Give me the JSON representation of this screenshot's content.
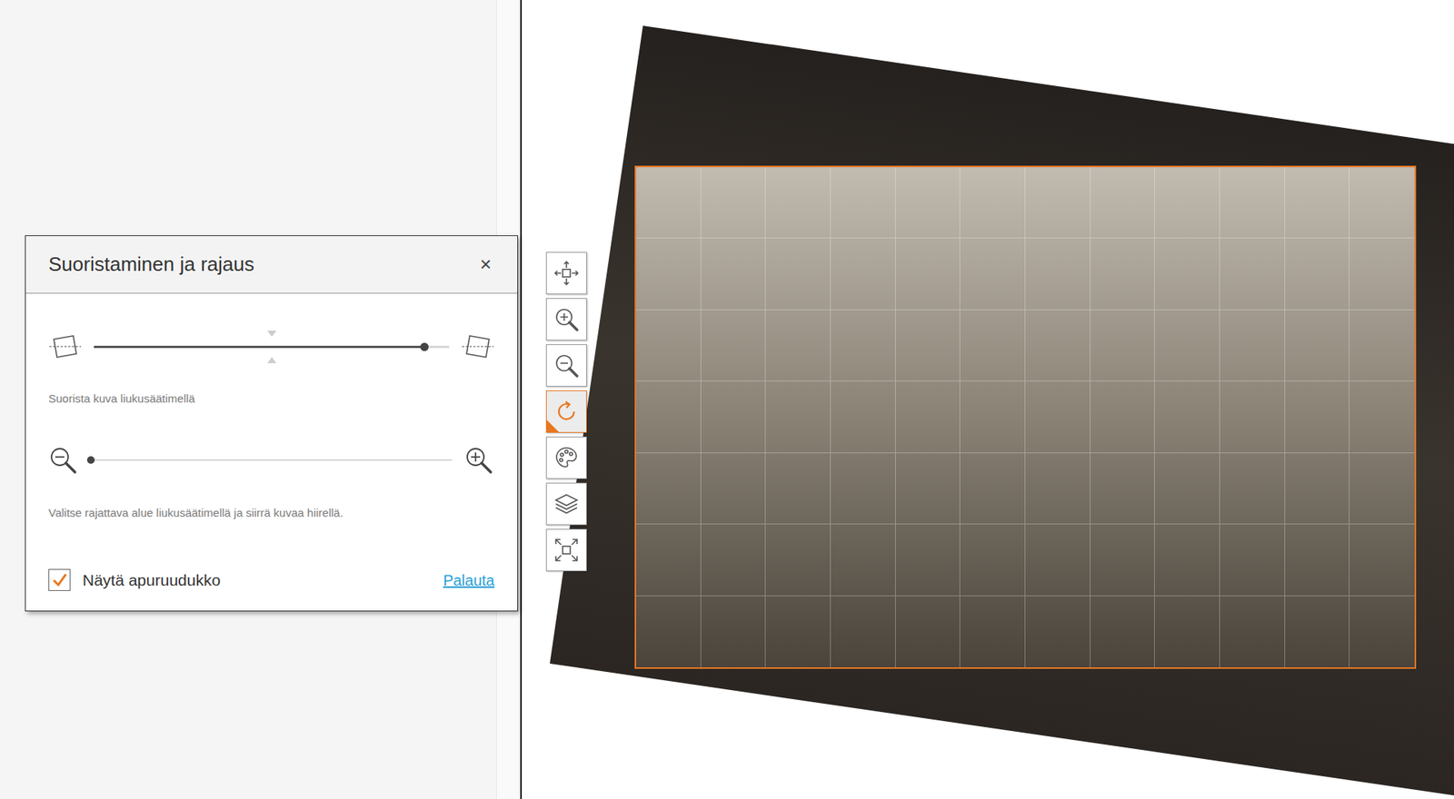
{
  "dialog": {
    "title": "Suoristaminen ja rajaus",
    "close": "×",
    "straighten": {
      "level": 0.93,
      "hint": "Suorista kuva liukusäätimellä"
    },
    "zoom": {
      "level": 0,
      "hint": "Valitse rajattava alue liukusäätimellä ja siirrä kuvaa hiirellä."
    },
    "grid_checkbox": {
      "label": "Näytä apuruudukko",
      "checked": true
    },
    "reset_link": "Palauta"
  },
  "toolbar": [
    {
      "kind": "move",
      "selected": false
    },
    {
      "kind": "zoom-in",
      "selected": false
    },
    {
      "kind": "zoom-out",
      "selected": false
    },
    {
      "kind": "rotate",
      "selected": true
    },
    {
      "kind": "palette",
      "selected": false
    },
    {
      "kind": "layers",
      "selected": false
    },
    {
      "kind": "fit",
      "selected": false
    }
  ]
}
